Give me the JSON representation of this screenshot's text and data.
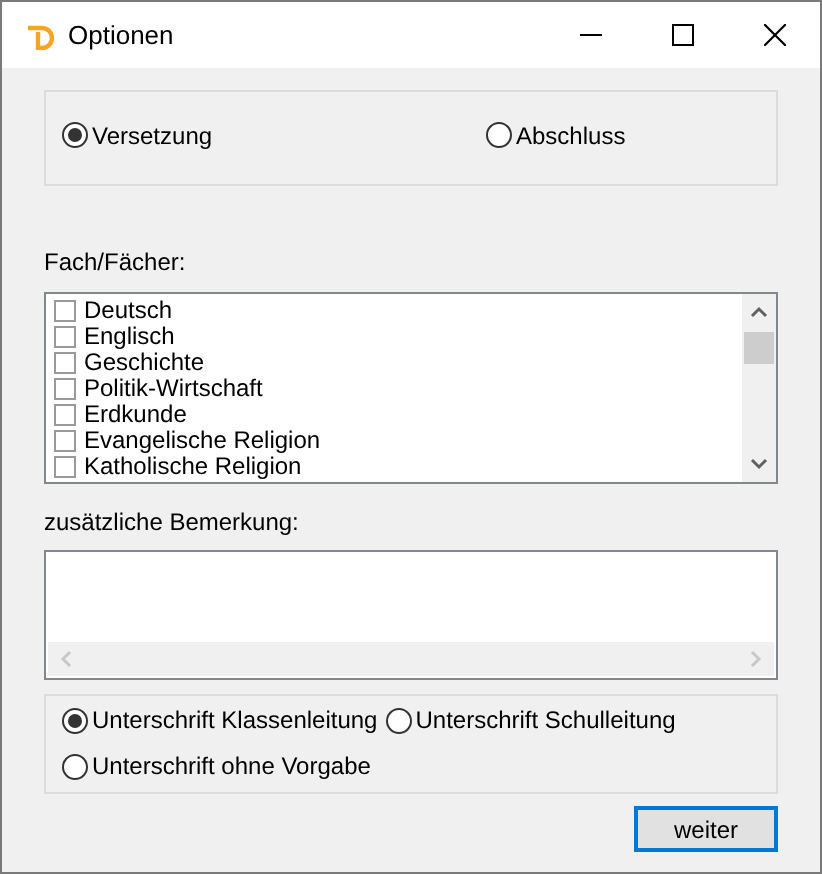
{
  "window": {
    "title": "Optionen"
  },
  "type_options": [
    {
      "label": "Versetzung",
      "selected": true
    },
    {
      "label": "Abschluss",
      "selected": false
    }
  ],
  "subjects_label": "Fach/Fächer:",
  "subjects": [
    {
      "label": "Deutsch",
      "checked": false
    },
    {
      "label": "Englisch",
      "checked": false
    },
    {
      "label": "Geschichte",
      "checked": false
    },
    {
      "label": "Politik-Wirtschaft",
      "checked": false
    },
    {
      "label": "Erdkunde",
      "checked": false
    },
    {
      "label": "Evangelische Religion",
      "checked": false
    },
    {
      "label": "Katholische Religion",
      "checked": false
    }
  ],
  "remark_label": "zusätzliche Bemerkung:",
  "signature_options": [
    {
      "label": "Unterschrift Klassenleitung",
      "selected": true
    },
    {
      "label": "Unterschrift Schulleitung",
      "selected": false
    },
    {
      "label": "Unterschrift ohne Vorgabe",
      "selected": false
    }
  ],
  "button": "weiter"
}
